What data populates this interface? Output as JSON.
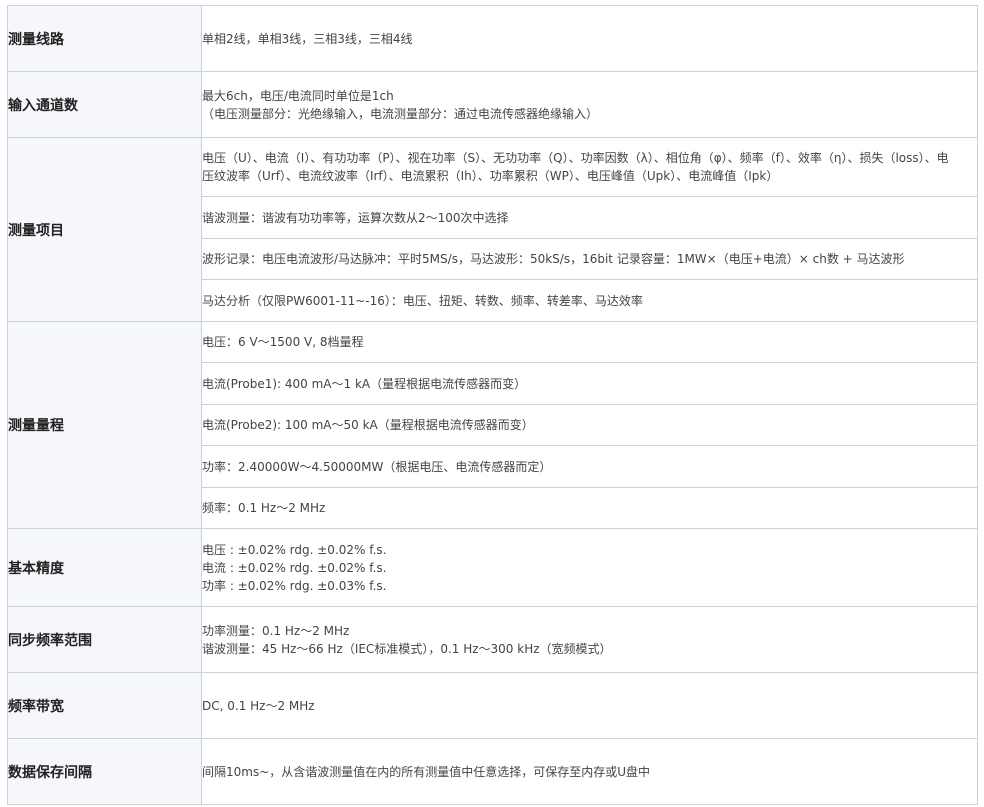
{
  "rows": [
    {
      "label": "测量线路",
      "values": [
        [
          "单相2线，单相3线，三相3线，三相4线"
        ]
      ]
    },
    {
      "label": "输入通道数",
      "values": [
        [
          "最大6ch，电压/电流同时单位是1ch",
          "（电压测量部分：光绝缘输入，电流测量部分：通过电流传感器绝缘输入）"
        ]
      ]
    },
    {
      "label": "测量项目",
      "values": [
        [
          "电压（U）、电流（I）、有功功率（P）、视在功率（S）、无功功率（Q）、功率因数（λ）、相位角（φ）、频率（f）、效率（η）、损失（loss）、电压纹波率（Urf）、电流纹波率（Irf）、电流累积（Ih）、功率累积（WP）、电压峰值（Upk）、电流峰值（Ipk）"
        ],
        [
          "谐波测量：谐波有功功率等，运算次数从2～100次中选择"
        ],
        [
          "波形记录：电压电流波形/马达脉冲：平时5MS/s，马达波形：50kS/s，16bit 记录容量：1MW×（电压+电流）× ch数 + 马达波形"
        ],
        [
          "马达分析（仅限PW6001-11~-16）：电压、扭矩、转数、频率、转差率、马达效率"
        ]
      ]
    },
    {
      "label": "测量量程",
      "values": [
        [
          "电压：6 V～1500 V, 8档量程"
        ],
        [
          "电流(Probe1): 400 mA～1 kA（量程根据电流传感器而变）"
        ],
        [
          "电流(Probe2): 100 mA～50 kA（量程根据电流传感器而变）"
        ],
        [
          "功率：2.40000W～4.50000MW（根据电压、电流传感器而定）"
        ],
        [
          "频率：0.1 Hz～2 MHz"
        ]
      ]
    },
    {
      "label": "基本精度",
      "values": [
        [
          "电压 : ±0.02% rdg. ±0.02% f.s.",
          "电流 : ±0.02% rdg. ±0.02% f.s.",
          "功率 : ±0.02% rdg. ±0.03% f.s."
        ]
      ]
    },
    {
      "label": "同步频率范围",
      "values": [
        [
          "功率测量：0.1 Hz～2 MHz",
          "谐波测量：45 Hz～66 Hz（IEC标准模式），0.1 Hz～300 kHz（宽频模式）"
        ]
      ]
    },
    {
      "label": "频率带宽",
      "values": [
        [
          "DC, 0.1 Hz～2 MHz"
        ]
      ]
    },
    {
      "label": "数据保存间隔",
      "values": [
        [
          "间隔10ms~，从含谐波测量值在内的所有测量值中任意选择，可保存至内存或U盘中"
        ]
      ]
    }
  ]
}
